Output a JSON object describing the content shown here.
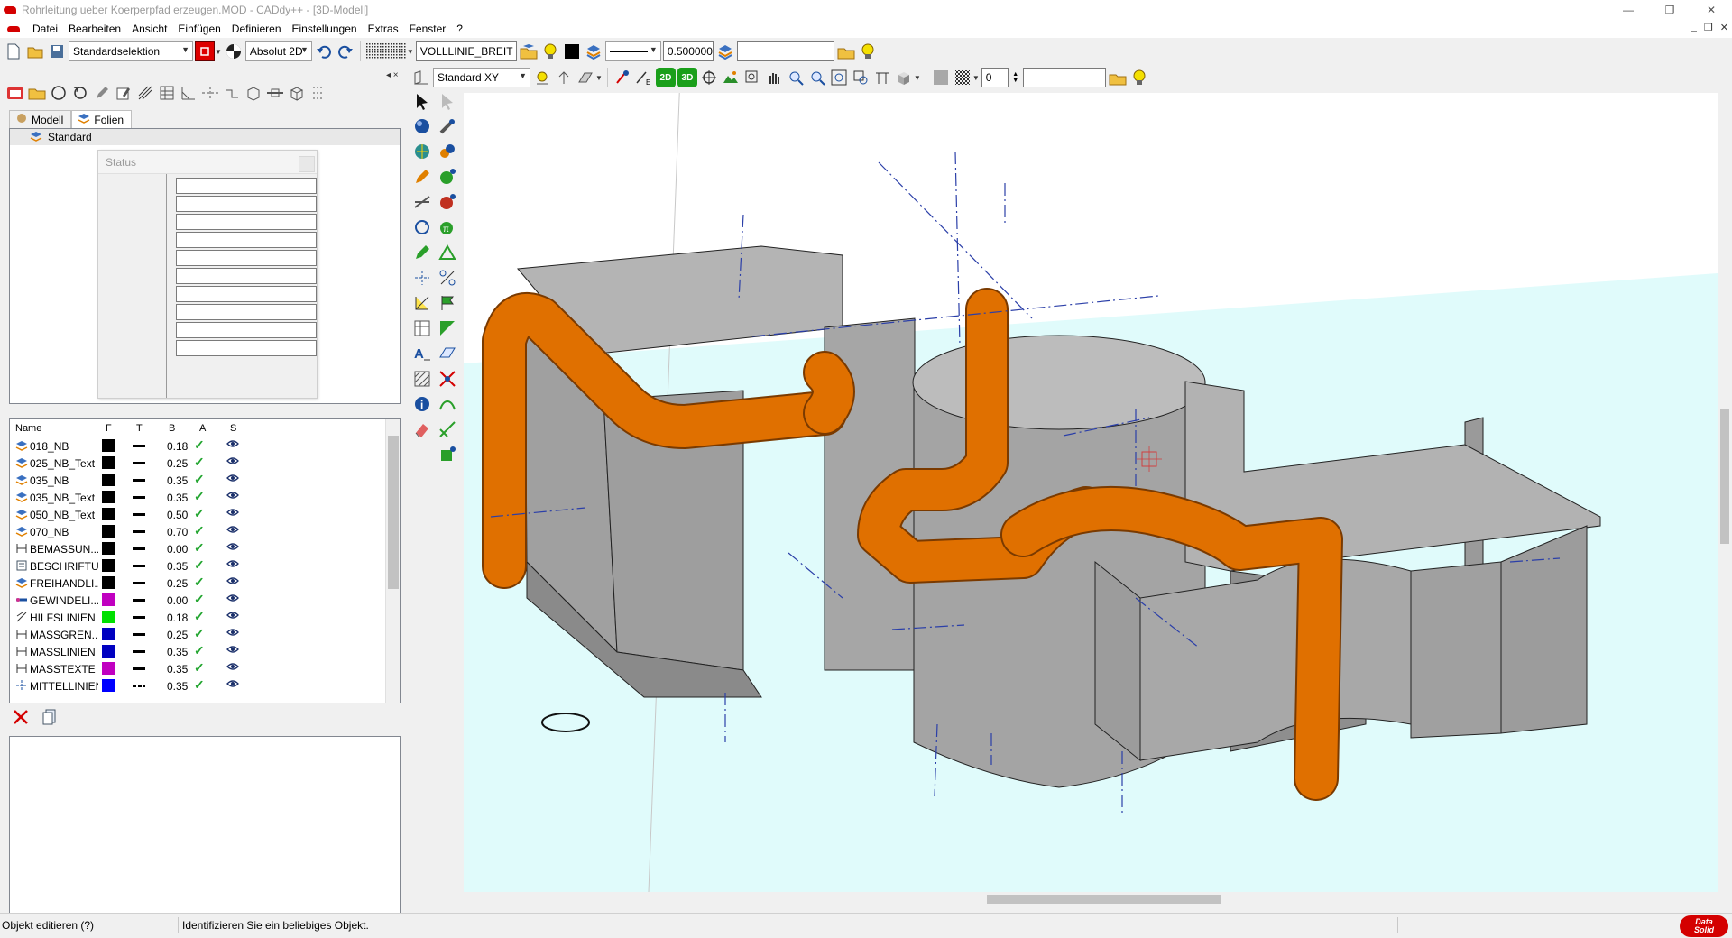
{
  "window": {
    "title": "Rohrleitung ueber Koerperpfad erzeugen.MOD  -  CADdy++ - [3D-Modell]",
    "min": "—",
    "restore": "❐",
    "close": "✕"
  },
  "menu": {
    "items": [
      "Datei",
      "Bearbeiten",
      "Ansicht",
      "Einfügen",
      "Definieren",
      "Einstellungen",
      "Extras",
      "Fenster",
      "?"
    ],
    "mdi": [
      "_",
      "❐",
      "✕"
    ]
  },
  "toolbar1": {
    "selection_mode": "Standardselektion",
    "coord_mode": "Absolut 2D",
    "line_type_name": "VOLLLINIE_BREIT",
    "line_width": "0.500000",
    "layer_value": ""
  },
  "viewport_toolbar": {
    "plane": "Standard XY",
    "view_2d": "2D",
    "view_3d": "3D",
    "spin_value": "0",
    "extra_value": ""
  },
  "left_dock": {
    "dock_controls": "◂ ×",
    "tabs": [
      {
        "label": "Modell",
        "active": false
      },
      {
        "label": "Folien",
        "active": true
      }
    ],
    "tree_root": "Standard",
    "status_window": {
      "title": "Status",
      "field_count": 10
    },
    "layers": {
      "columns": {
        "name": "Name",
        "f": "F",
        "t": "T",
        "b": "B",
        "a": "A",
        "s": "S"
      },
      "rows": [
        {
          "name": "018_NB",
          "color": "#000000",
          "width": "0.18",
          "icon": "layer",
          "dashed": false
        },
        {
          "name": "025_NB_Text",
          "color": "#000000",
          "width": "0.25",
          "icon": "layer",
          "dashed": false
        },
        {
          "name": "035_NB",
          "color": "#000000",
          "width": "0.35",
          "icon": "layer",
          "dashed": false
        },
        {
          "name": "035_NB_Text",
          "color": "#000000",
          "width": "0.35",
          "icon": "layer",
          "dashed": false
        },
        {
          "name": "050_NB_Text",
          "color": "#000000",
          "width": "0.50",
          "icon": "layer",
          "dashed": false
        },
        {
          "name": "070_NB",
          "color": "#000000",
          "width": "0.70",
          "icon": "layer",
          "dashed": false
        },
        {
          "name": "BEMASSUN...",
          "color": "#000000",
          "width": "0.00",
          "icon": "dimension",
          "dashed": false
        },
        {
          "name": "BESCHRIFTU...",
          "color": "#000000",
          "width": "0.35",
          "icon": "text",
          "dashed": false
        },
        {
          "name": "FREIHANDLI...",
          "color": "#000000",
          "width": "0.25",
          "icon": "layer",
          "dashed": false
        },
        {
          "name": "GEWINDELI...",
          "color": "#c000c0",
          "width": "0.00",
          "icon": "thread",
          "dashed": false
        },
        {
          "name": "HILFSLINIEN",
          "color": "#00e000",
          "width": "0.18",
          "icon": "helper",
          "dashed": false
        },
        {
          "name": "MASSGREN...",
          "color": "#0000c0",
          "width": "0.25",
          "icon": "dimension",
          "dashed": false
        },
        {
          "name": "MASSLINIEN",
          "color": "#0000c0",
          "width": "0.35",
          "icon": "dimension",
          "dashed": false
        },
        {
          "name": "MASSTEXTE",
          "color": "#c000c0",
          "width": "0.35",
          "icon": "dimension",
          "dashed": false
        },
        {
          "name": "MITTELLINIEN",
          "color": "#0000ff",
          "width": "0.35",
          "icon": "centerline",
          "dashed": true
        }
      ]
    }
  },
  "statusbar": {
    "command": "Objekt editieren (?)",
    "prompt": "Identifizieren Sie ein beliebiges Objekt.",
    "brand_top": "Data",
    "brand_bottom": "Solid"
  },
  "colors": {
    "pipe": "#e07000",
    "solid": "#a8a8a8",
    "ground": "#e0fbfb",
    "centerline": "#2b3fa8"
  }
}
